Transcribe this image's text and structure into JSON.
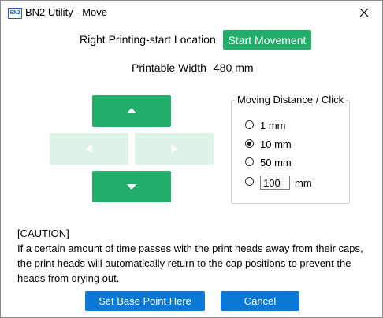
{
  "window": {
    "title": "BN2 Utility - Move",
    "app_icon_text": "BN2",
    "close_icon": "close-x-icon"
  },
  "location": {
    "label": "Right Printing-start Location",
    "start_button": "Start Movement"
  },
  "printable": {
    "label": "Printable Width",
    "value": "480 mm"
  },
  "arrows": {
    "up": {
      "icon": "arrow-up-icon",
      "enabled": true
    },
    "left": {
      "icon": "arrow-left-icon",
      "enabled": false
    },
    "right": {
      "icon": "arrow-right-icon",
      "enabled": false
    },
    "down": {
      "icon": "arrow-down-icon",
      "enabled": true
    }
  },
  "distance": {
    "legend": "Moving Distance / Click",
    "options": [
      {
        "label": "1 mm",
        "selected": false
      },
      {
        "label": "10 mm",
        "selected": true
      },
      {
        "label": "50 mm",
        "selected": false
      }
    ],
    "custom_value": "100",
    "custom_unit": "mm"
  },
  "caution": {
    "heading": "[CAUTION]",
    "text": "If a certain amount of time passes with the print heads away from their caps, the print heads will automatically return to the cap positions to prevent the heads from drying out."
  },
  "footer": {
    "base_point_button": "Set Base Point Here",
    "cancel_button": "Cancel"
  },
  "colors": {
    "accent_green": "#23ad6a",
    "disabled_green": "#dcf3e6",
    "button_blue": "#0a78d6"
  }
}
